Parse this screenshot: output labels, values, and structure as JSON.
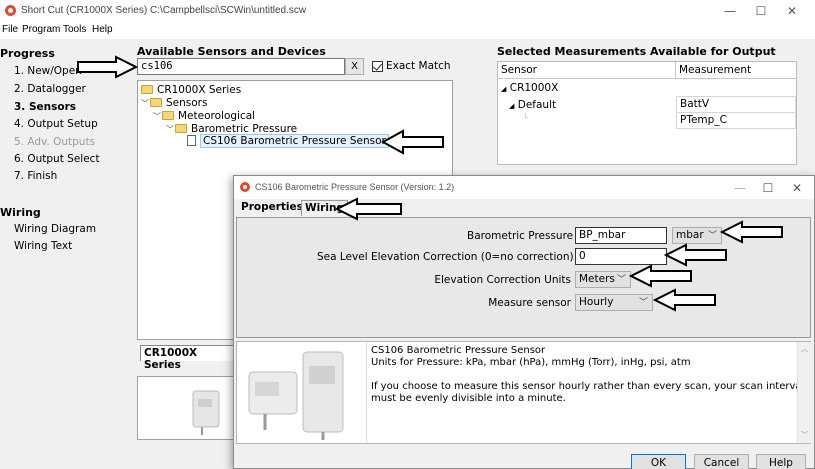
{
  "window": {
    "title": "Short Cut (CR1000X Series) C:\\Campbellsci\\SCWin\\untitled.scw",
    "minimize": "—",
    "maximize": "☐",
    "close": "✕"
  },
  "menu": [
    "File",
    "Program",
    "Tools",
    "Help"
  ],
  "progress": {
    "heading": "Progress",
    "steps": [
      "1. New/Open",
      "2. Datalogger",
      "3. Sensors",
      "4. Output Setup",
      "5. Adv. Outputs",
      "6. Output Select",
      "7. Finish"
    ],
    "current": "3. Sensors",
    "disabled": "5. Adv. Outputs"
  },
  "wiring": {
    "heading": "Wiring",
    "items": [
      "Wiring Diagram",
      "Wiring Text"
    ]
  },
  "sensors": {
    "heading": "Available Sensors and Devices",
    "search_value": "cs106",
    "clear_label": "X",
    "exact_match_label": "Exact Match",
    "exact_match_checked": true,
    "tree": [
      "CR1000X Series",
      "Sensors",
      "Meteorological",
      "Barometric Pressure",
      "CS106 Barometric Pressure Sensor"
    ],
    "tab_label": "CR1000X Series"
  },
  "measurements": {
    "heading": "Selected Measurements Available for Output",
    "col_sensor": "Sensor",
    "col_measurement": "Measurement",
    "rows": [
      {
        "sensor": "CR1000X",
        "measurement": ""
      },
      {
        "sensor": "Default",
        "measurement": "BattV"
      },
      {
        "sensor": "",
        "measurement": "PTemp_C"
      }
    ]
  },
  "dialog": {
    "title": "CS106 Barometric Pressure Sensor (Version: 1.2)",
    "tab_properties": "Properties",
    "tab_wiring": "Wiring",
    "fields": {
      "baro_label": "Barometric Pressure",
      "baro_value": "BP_mbar",
      "baro_unit": "mbar",
      "sea_label": "Sea Level Elevation Correction (0=no correction)",
      "sea_value": "0",
      "elev_units_label": "Elevation Correction Units",
      "elev_units_value": "Meters",
      "measure_label": "Measure sensor",
      "measure_value": "Hourly"
    },
    "description": {
      "line1": "CS106 Barometric Pressure Sensor",
      "line2": "Units for Pressure: kPa, mbar (hPa), mmHg (Torr), inHg, psi, atm",
      "line3": "If you choose to measure this sensor hourly rather than every scan, your scan interval",
      "line4": "must be evenly divisible into a minute."
    },
    "buttons": {
      "ok": "OK",
      "cancel": "Cancel",
      "help": "Help"
    }
  },
  "colors": {
    "accent": "#0078d7",
    "app_icon": "#e04a2f",
    "folder": "#f7d774"
  }
}
